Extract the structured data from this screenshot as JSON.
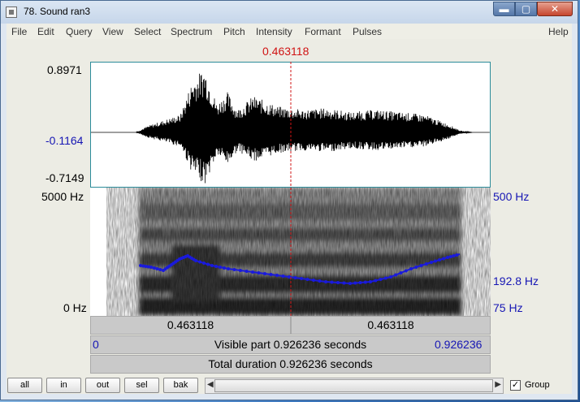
{
  "window": {
    "title": "78. Sound ran3",
    "min_glyph": "▬",
    "max_glyph": "▢",
    "close_glyph": "✕"
  },
  "menu": {
    "items": [
      "File",
      "Edit",
      "Query",
      "View",
      "Select",
      "Spectrum",
      "Pitch",
      "Intensity",
      "Formant",
      "Pulses"
    ],
    "help": "Help"
  },
  "cursor": {
    "time_label": "0.463118",
    "time_fraction": 0.5
  },
  "waveform": {
    "max_label": "0.8971",
    "mid_label": "-0.1164",
    "min_label": "-0.7149"
  },
  "spectrogram": {
    "top_label": "5000 Hz",
    "bottom_label": "0 Hz"
  },
  "pitch": {
    "top_label": "500 Hz",
    "value_label": "192.8 Hz",
    "bottom_label": "75 Hz",
    "line_color": "#1a1adc"
  },
  "selection_bar": {
    "left": "0.463118",
    "right": "0.463118"
  },
  "visible_bar": {
    "start": "0",
    "text": "Visible part 0.926236 seconds",
    "end": "0.926236"
  },
  "total_bar": {
    "text": "Total duration 0.926236 seconds"
  },
  "buttons": {
    "all": "all",
    "in": "in",
    "out": "out",
    "sel": "sel",
    "bak": "bak"
  },
  "scroll_left_glyph": "◀",
  "scroll_right_glyph": "▶",
  "group": {
    "label": "Group",
    "checked": "✓"
  },
  "colors": {
    "cursor": "#d01414",
    "axis_blue": "#1616b4",
    "frame": "#2c8c9a"
  }
}
